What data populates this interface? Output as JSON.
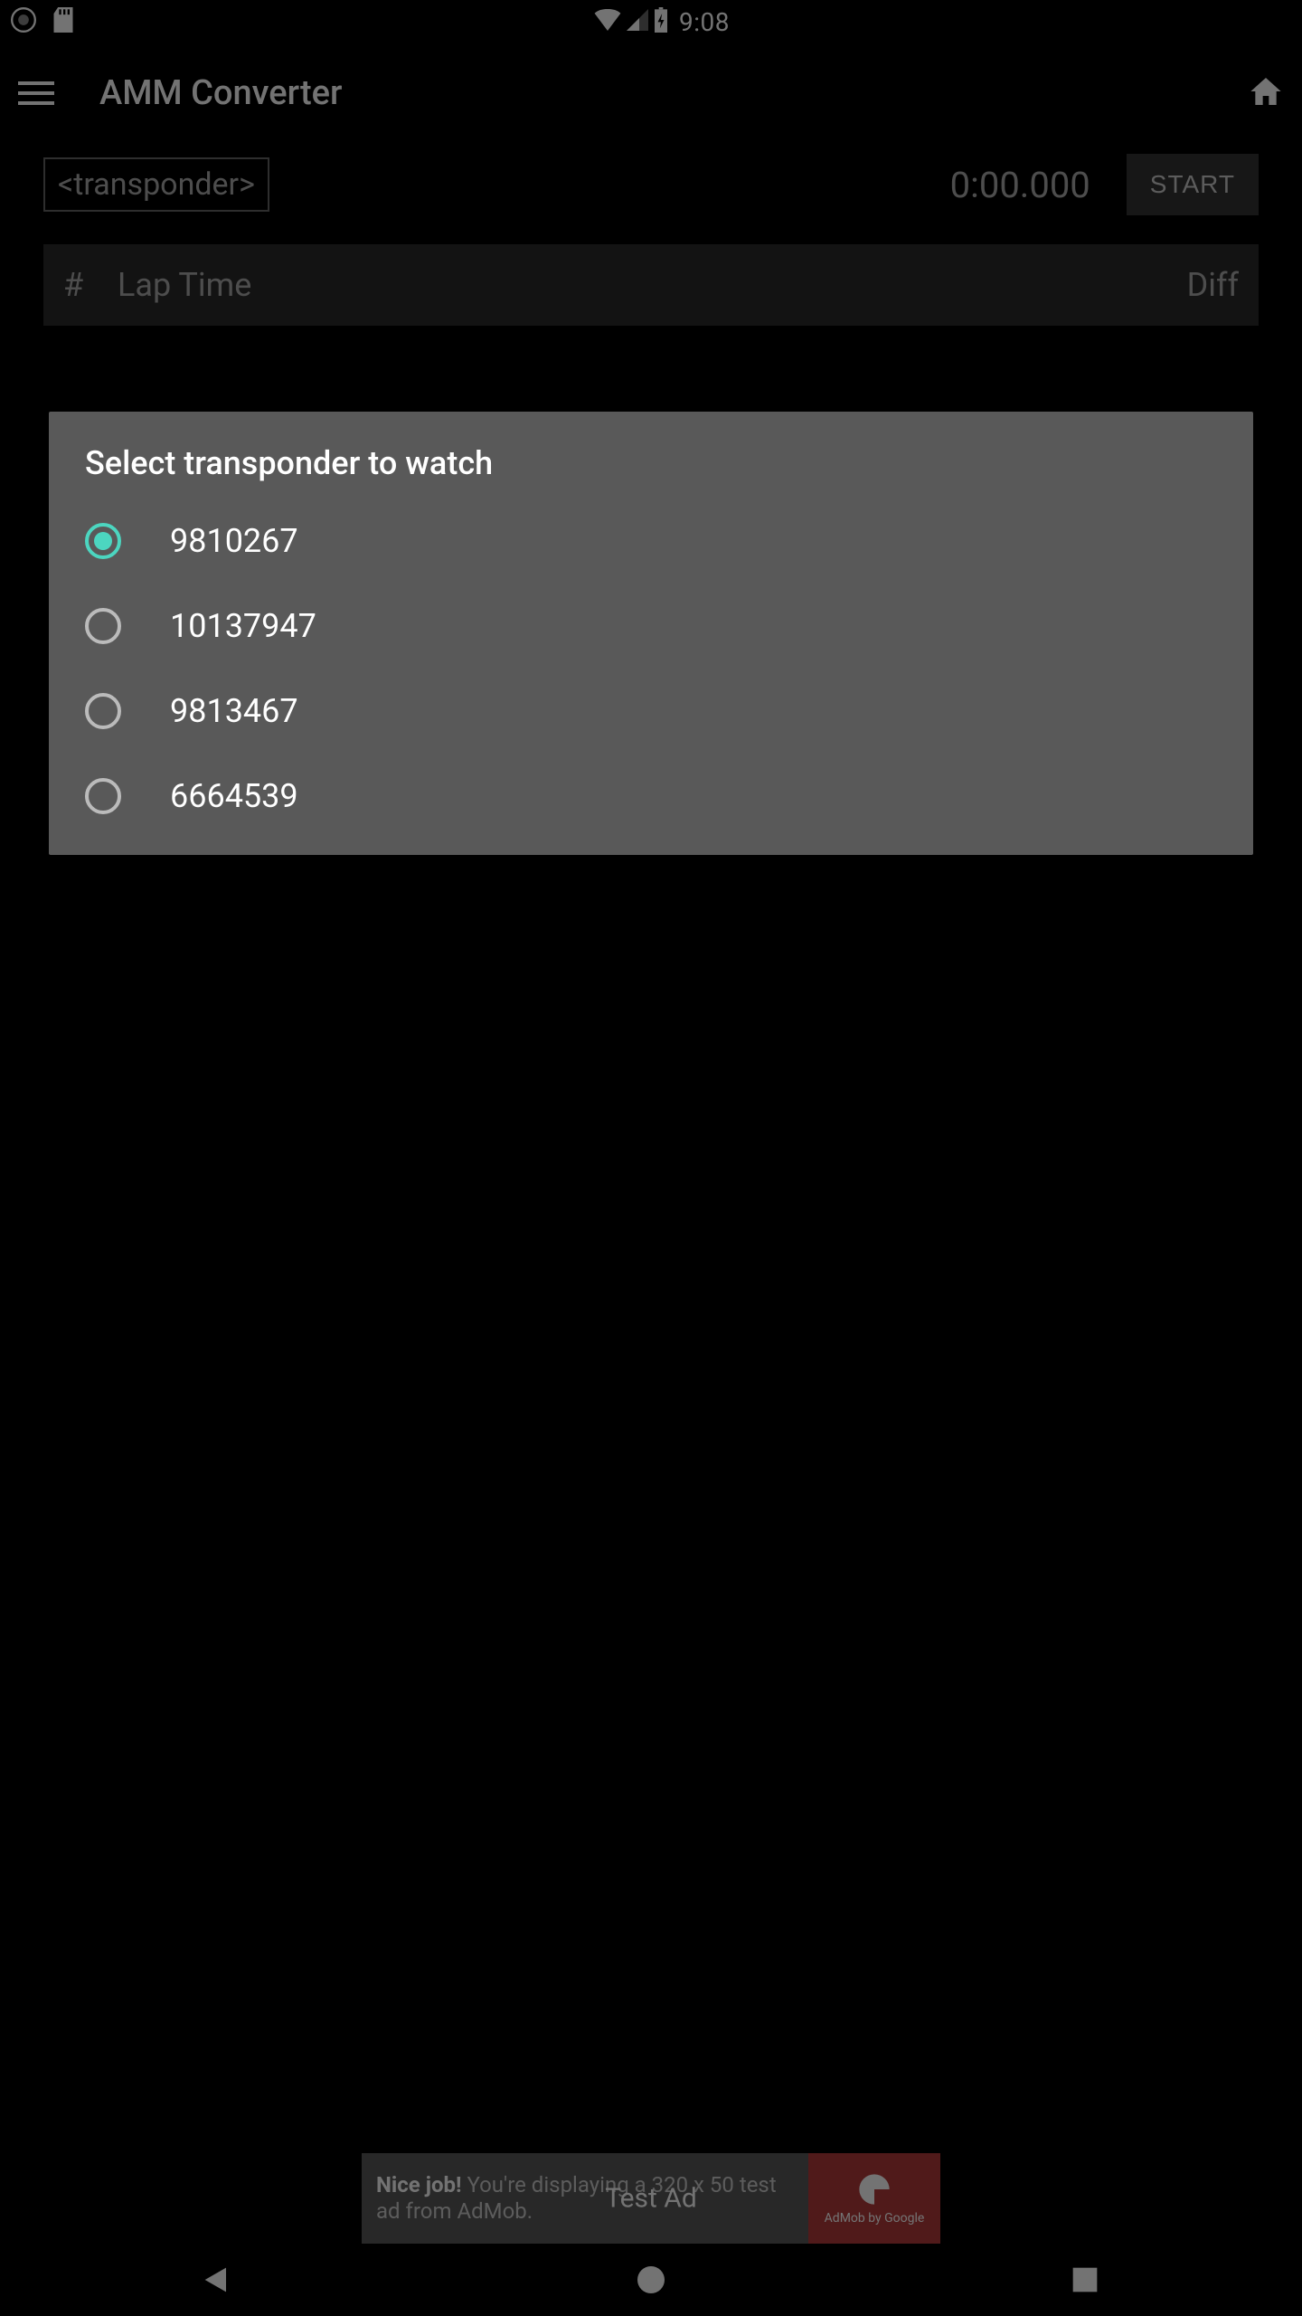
{
  "status": {
    "time": "9:08"
  },
  "toolbar": {
    "title": "AMM Converter"
  },
  "main": {
    "transponder_placeholder": "<transponder>",
    "timer": "0:00.000",
    "start_label": "START",
    "columns": {
      "num": "#",
      "lap": "Lap Time",
      "diff": "Diff"
    }
  },
  "dialog": {
    "title": "Select transponder to watch",
    "options": [
      {
        "label": "9810267",
        "checked": true
      },
      {
        "label": "10137947",
        "checked": false
      },
      {
        "label": "9813467",
        "checked": false
      },
      {
        "label": "6664539",
        "checked": false
      }
    ]
  },
  "ad": {
    "headline": "Nice job!",
    "body": "You're displaying a 320 x 50 test ad from AdMob.",
    "overlay": "Test Ad",
    "brand": "AdMob by Google"
  }
}
